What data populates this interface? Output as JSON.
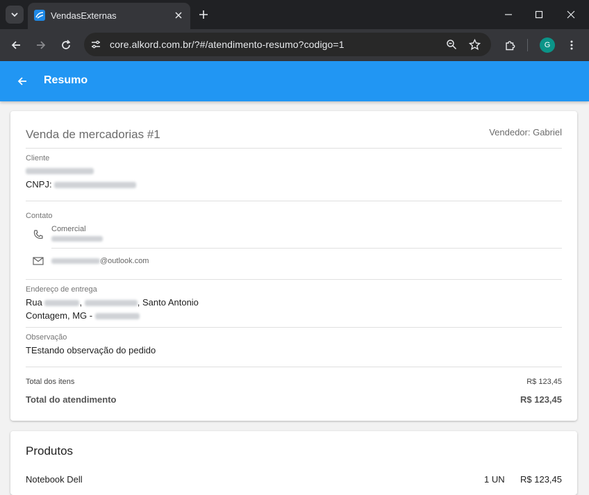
{
  "browser": {
    "tab_title": "VendasExternas",
    "url": "core.alkord.com.br/?#/atendimento-resumo?codigo=1",
    "profile_initial": "G"
  },
  "appbar": {
    "title": "Resumo"
  },
  "summary": {
    "title": "Venda de mercadorias #1",
    "seller": "Vendedor: Gabriel",
    "client": {
      "label": "Cliente",
      "cnpj_label": "CNPJ:"
    },
    "contact": {
      "label": "Contato",
      "phone_type": "Comercial",
      "email_suffix": "@outlook.com"
    },
    "address": {
      "label": "Endereço de entrega",
      "street_prefix": "Rua",
      "sep": ",",
      "neighborhood": ", Santo Antonio",
      "city": "Contagem, MG -"
    },
    "note": {
      "label": "Observação",
      "text": "TEstando observação do pedido"
    },
    "totals": {
      "items_label": "Total dos itens",
      "items_value": "R$ 123,45",
      "total_label": "Total do atendimento",
      "total_value": "R$ 123,45"
    }
  },
  "products": {
    "title": "Produtos",
    "items": [
      {
        "name": "Notebook Dell",
        "qty": "1 UN",
        "price": "R$ 123,45"
      }
    ]
  }
}
